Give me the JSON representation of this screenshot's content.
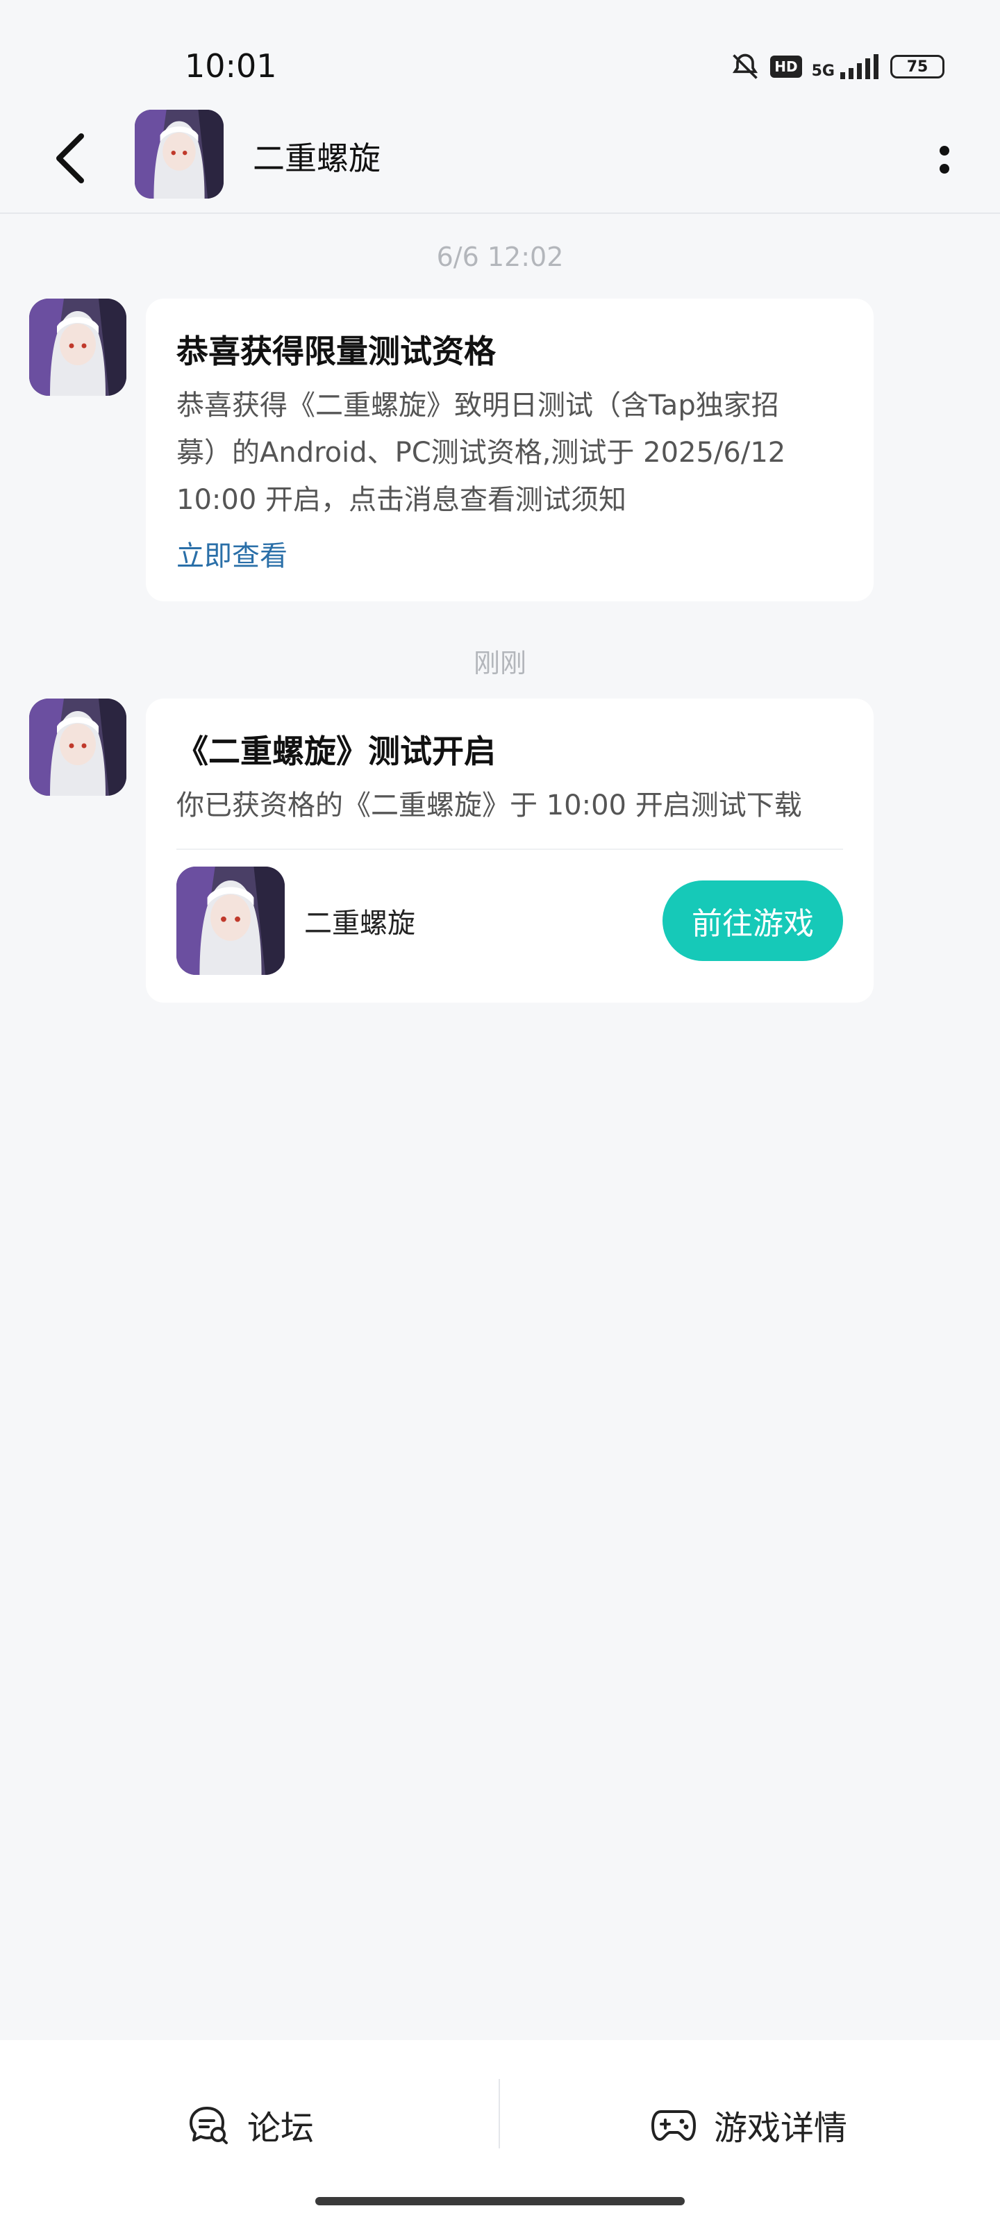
{
  "status_bar": {
    "time": "10:01",
    "hd_label": "HD",
    "network_label": "5G",
    "battery": "75",
    "icons": [
      "mute-icon",
      "hd-icon",
      "signal-icon",
      "battery-icon"
    ]
  },
  "header": {
    "title": "二重螺旋",
    "back_icon": "chevron-left-icon",
    "more_icon": "more-vertical-icon",
    "avatar": "game-avatar"
  },
  "messages": [
    {
      "timestamp": "6/6  12:02",
      "title": "恭喜获得限量测试资格",
      "body_lines": [
        "恭喜获得《二重螺旋》致明日测试（含Tap独家招",
        "募）的Android、PC测试资格,测试于 2025/6/12",
        "10:00 开启，点击消息查看测试须知"
      ],
      "link": "立即查看"
    },
    {
      "timestamp": "刚刚",
      "title": "《二重螺旋》测试开启",
      "body": "你已获资格的《二重螺旋》于 10:00 开启测试下载",
      "game_name": "二重螺旋",
      "button": "前往游戏"
    }
  ],
  "bottom_tabs": [
    {
      "label": "论坛",
      "icon": "forum-chat-icon"
    },
    {
      "label": "游戏详情",
      "icon": "gamepad-icon"
    }
  ],
  "colors": {
    "background": "#f6f7f9",
    "accent": "#16c9b8",
    "link": "#2a6fa8"
  }
}
